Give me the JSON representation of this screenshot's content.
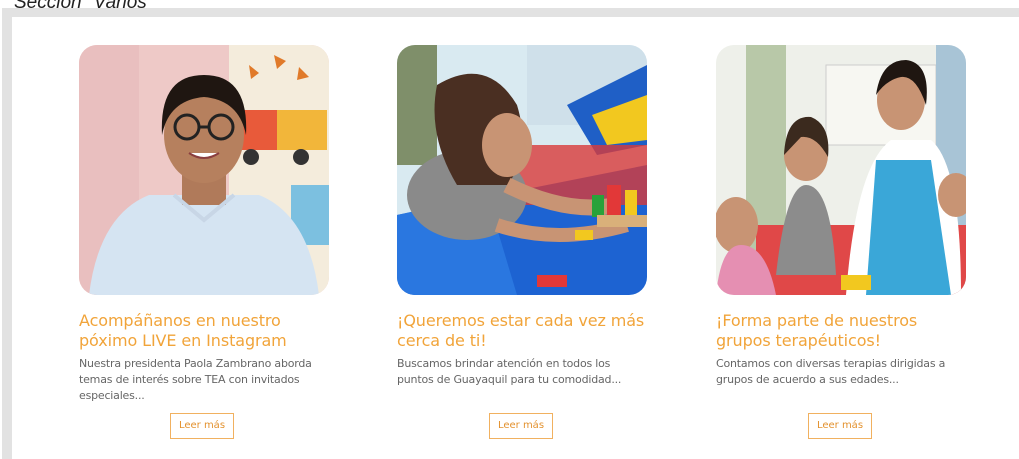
{
  "section_label": "Sección \"Varios\"",
  "cards": [
    {
      "title": "Acompáñanos en nuestro\npóximo LIVE en Instagram",
      "text": "Nuestra presidenta Paola Zambrano aborda\ntemas de interés sobre TEA con invitados\nespeciales...",
      "button": "Leer más",
      "image_alt": "woman-with-glasses-photo"
    },
    {
      "title": "¡Queremos estar cada vez más\ncerca de ti!",
      "text": "Buscamos brindar atención en todos los\npuntos de Guayaquil para tu comodidad...",
      "button": "Leer más",
      "image_alt": "girl-playing-blocks-photo"
    },
    {
      "title": "¡Forma parte de nuestros\ngrupos terapéuticos!",
      "text": "Contamos con diversas terapias dirigidas a\ngrupos de acuerdo a sus edades...",
      "button": "Leer más",
      "image_alt": "therapy-group-photo"
    }
  ]
}
